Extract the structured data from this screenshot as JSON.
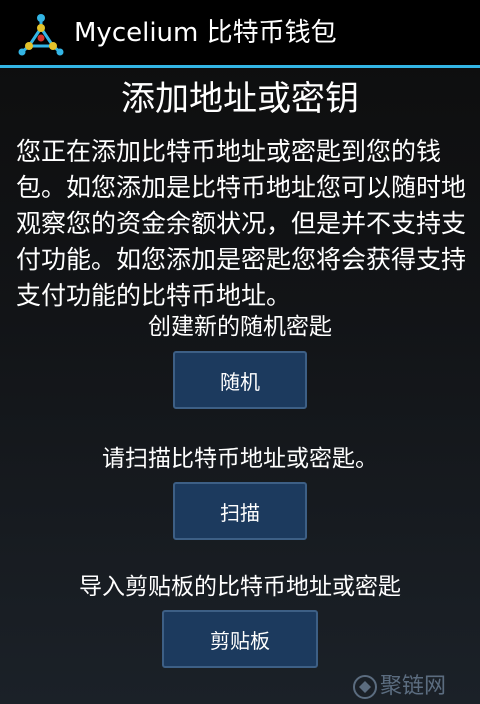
{
  "action_bar": {
    "logo_icon": "mycelium-logo-icon",
    "title": "Mycelium 比特币钱包",
    "accent_color": "#33b5e5"
  },
  "page": {
    "title": "添加地址或密钥",
    "description": "您正在添加比特币地址或密匙到您的钱包。如您添加是比特币地址您可以随时地观察您的资金余额状况，但是并不支持支付功能。如您添加是密匙您将会获得支持支付功能的比特币地址。"
  },
  "sections": {
    "random": {
      "label": "创建新的随机密匙",
      "button": "随机"
    },
    "scan": {
      "label": "请扫描比特币地址或密匙。",
      "button": "扫描"
    },
    "clipboard": {
      "label": "导入剪贴板的比特币地址或密匙",
      "button": "剪贴板"
    }
  },
  "watermark": {
    "text": "聚链网",
    "icon": "watermark-logo-icon"
  }
}
